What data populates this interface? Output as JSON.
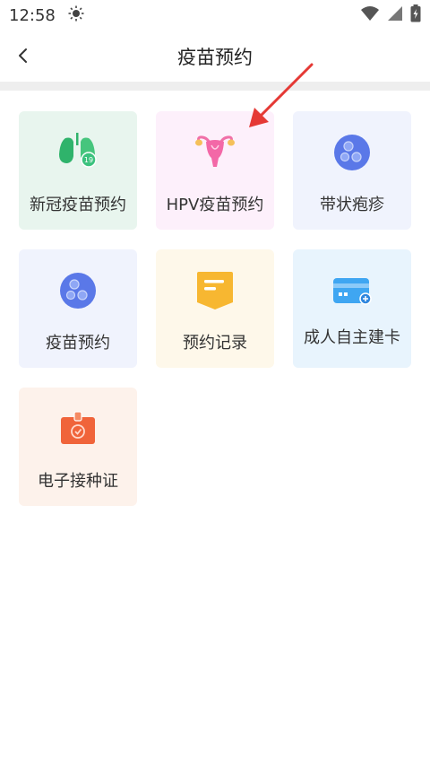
{
  "status_bar": {
    "time": "12:58"
  },
  "nav": {
    "title": "疫苗预约"
  },
  "tiles": [
    {
      "label": "新冠疫苗预约",
      "icon": "lungs-virus-icon",
      "bg": "#e8f5ee"
    },
    {
      "label": "HPV疫苗预约",
      "icon": "uterus-icon",
      "bg": "#fdf0fb"
    },
    {
      "label": "带状疱疹",
      "icon": "cells-icon",
      "bg": "#f0f3fd"
    },
    {
      "label": "疫苗预约",
      "icon": "cells-icon",
      "bg": "#f0f3fd"
    },
    {
      "label": "预约记录",
      "icon": "note-icon",
      "bg": "#fef8ea"
    },
    {
      "label": "成人自主建卡",
      "icon": "card-icon",
      "bg": "#e8f4fd"
    },
    {
      "label": "电子接种证",
      "icon": "certificate-icon",
      "bg": "#fdf2eb"
    }
  ],
  "colors": {
    "annotation_arrow": "#e53935"
  }
}
